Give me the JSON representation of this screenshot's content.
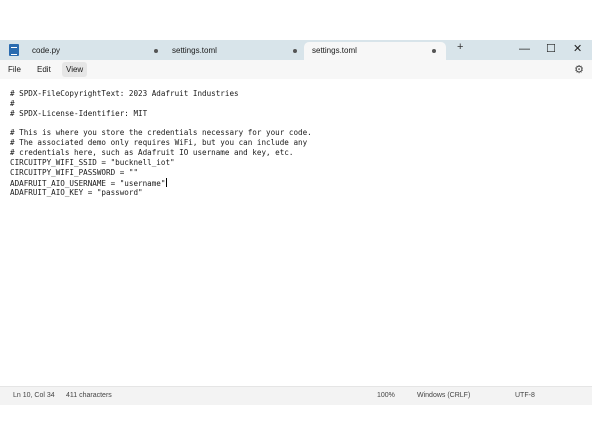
{
  "tabs": [
    {
      "label": "code.py",
      "modified": true,
      "active": false
    },
    {
      "label": "settings.toml",
      "modified": true,
      "active": false
    },
    {
      "label": "settings.toml",
      "modified": true,
      "active": true
    }
  ],
  "window_controls": {
    "minimize": "—",
    "maximize": "☐",
    "close": "✕"
  },
  "new_tab": "+",
  "menu": {
    "file": "File",
    "edit": "Edit",
    "view": "View"
  },
  "editor": {
    "lines": [
      "# SPDX-FileCopyrightText: 2023 Adafruit Industries",
      "#",
      "# SPDX-License-Identifier: MIT",
      "",
      "# This is where you store the credentials necessary for your code.",
      "# The associated demo only requires WiFi, but you can include any",
      "# credentials here, such as Adafruit IO username and key, etc.",
      "CIRCUITPY_WIFI_SSID = \"bucknell_iot\"",
      "CIRCUITPY_WIFI_PASSWORD = \"\"",
      "ADAFRUIT_AIO_USERNAME = \"username\"",
      "ADAFRUIT_AIO_KEY = \"password\""
    ]
  },
  "status": {
    "position": "Ln 10, Col 34",
    "characters": "411 characters",
    "zoom": "100%",
    "line_ending": "Windows (CRLF)",
    "encoding": "UTF-8"
  },
  "colors": {
    "titlebar": "#d8e4ea",
    "menubar": "#f7f7f7",
    "statusbar": "#f3f3f3"
  }
}
